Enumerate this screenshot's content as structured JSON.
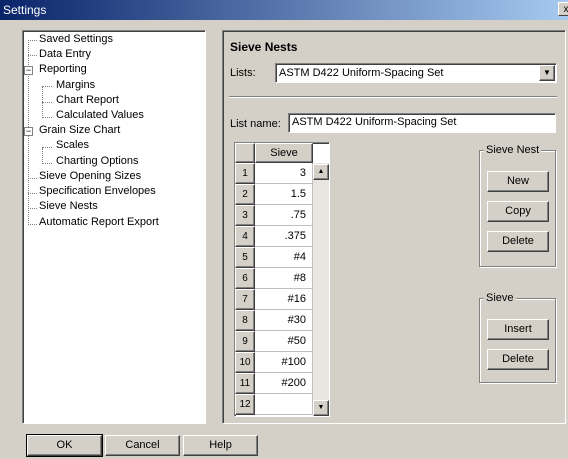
{
  "window": {
    "title": "Settings",
    "close_label": "x"
  },
  "tree": {
    "items": [
      {
        "label": "Saved Settings"
      },
      {
        "label": "Data Entry"
      },
      {
        "label": "Reporting",
        "expander": "−"
      },
      {
        "label": "Margins"
      },
      {
        "label": "Chart Report"
      },
      {
        "label": "Calculated Values"
      },
      {
        "label": "Grain Size Chart",
        "expander": "−"
      },
      {
        "label": "Scales"
      },
      {
        "label": "Charting Options"
      },
      {
        "label": "Sieve Opening Sizes"
      },
      {
        "label": "Specification Envelopes"
      },
      {
        "label": "Sieve Nests"
      },
      {
        "label": "Automatic Report Export"
      }
    ]
  },
  "panel": {
    "title": "Sieve Nests",
    "lists_label": "Lists:",
    "lists_value": "ASTM D422 Uniform-Spacing Set",
    "list_name_label": "List name:",
    "list_name_value": "ASTM D422 Uniform-Spacing Set"
  },
  "grid": {
    "column_header": "Sieve",
    "rows": [
      {
        "num": "1",
        "value": "3"
      },
      {
        "num": "2",
        "value": "1.5"
      },
      {
        "num": "3",
        "value": ".75"
      },
      {
        "num": "4",
        "value": ".375"
      },
      {
        "num": "5",
        "value": "#4"
      },
      {
        "num": "6",
        "value": "#8"
      },
      {
        "num": "7",
        "value": "#16"
      },
      {
        "num": "8",
        "value": "#30"
      },
      {
        "num": "9",
        "value": "#50"
      },
      {
        "num": "10",
        "value": "#100"
      },
      {
        "num": "11",
        "value": "#200"
      },
      {
        "num": "12",
        "value": ""
      }
    ],
    "scroll_up_icon": "▲",
    "scroll_down_icon": "▼"
  },
  "sieve_nest_group": {
    "title": "Sieve Nest",
    "new_label": "New",
    "copy_label": "Copy",
    "delete_label": "Delete"
  },
  "sieve_group": {
    "title": "Sieve",
    "insert_label": "Insert",
    "delete_label": "Delete"
  },
  "footer": {
    "ok_label": "OK",
    "cancel_label": "Cancel",
    "help_label": "Help"
  },
  "icons": {
    "combo_dropdown": "▼"
  }
}
